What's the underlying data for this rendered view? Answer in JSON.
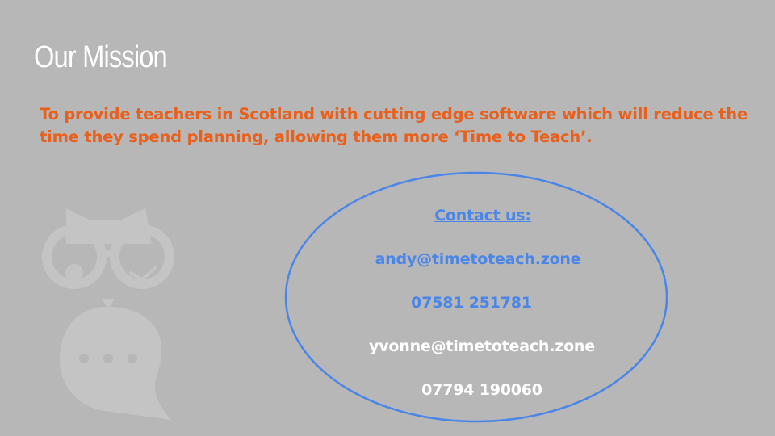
{
  "slide": {
    "title": "Our Mission",
    "mission_text": "To provide teachers in Scotland with cutting edge software which will reduce the time they spend planning, allowing them more ‘Time to Teach’.",
    "colors": {
      "background": "#b7b7b7",
      "title": "#ffffff",
      "mission": "#e8601c",
      "contact_blue": "#4a86e8",
      "contact_white": "#ffffff",
      "owl": "#c4c4c4"
    }
  },
  "contact": {
    "heading": "Contact us:",
    "email_1": "andy@timetoteach.zone",
    "phone_1": "07581 251781",
    "email_2": "yvonne@timetoteach.zone",
    "phone_2": "07794 190060"
  },
  "graphics": {
    "logo": "owl-logo-icon",
    "contact_frame": "ellipse-outline"
  }
}
